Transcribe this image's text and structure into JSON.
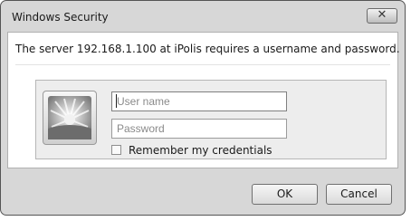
{
  "window": {
    "title": "Windows Security",
    "close_glyph": "✕"
  },
  "message": "The server 192.168.1.100 at iPolis requires a username and password.",
  "credentials": {
    "avatar_icon": "user-tile-icon",
    "username_placeholder": "User name",
    "username_value": "",
    "password_placeholder": "Password",
    "password_value": "",
    "remember_label": "Remember my credentials",
    "remember_checked": false
  },
  "buttons": {
    "ok_label": "OK",
    "cancel_label": "Cancel"
  },
  "colors": {
    "frame": "#d7d7d7",
    "panel": "#ededed"
  }
}
